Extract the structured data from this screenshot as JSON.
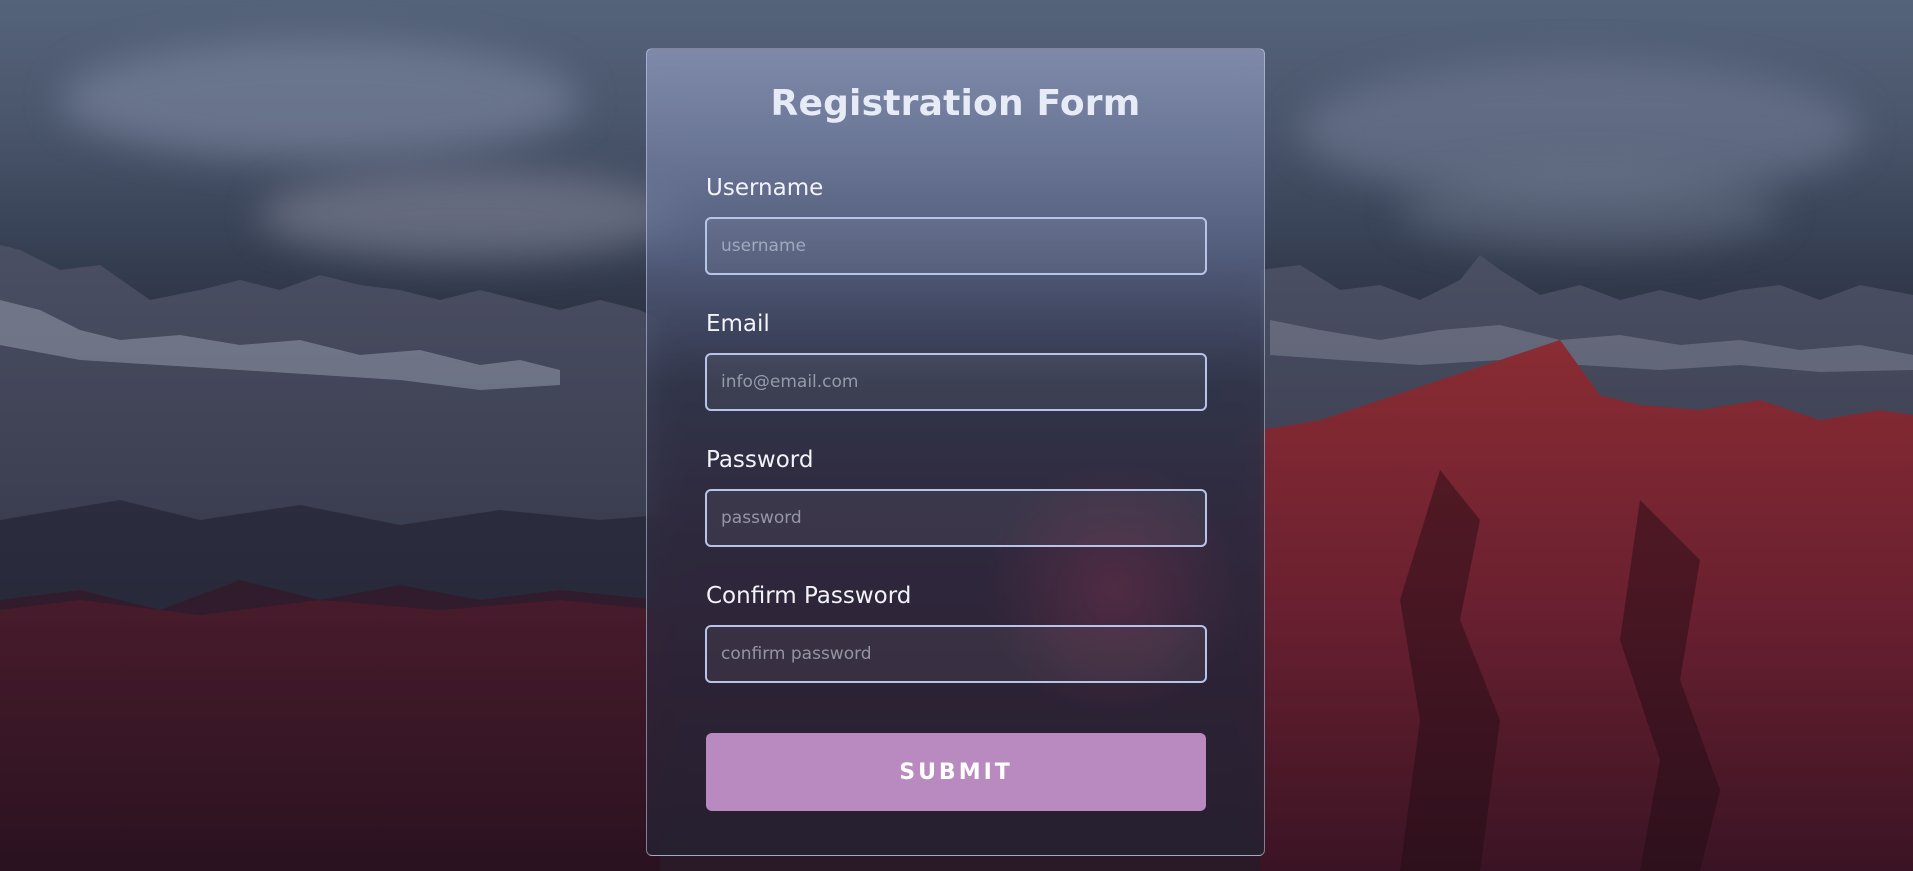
{
  "form": {
    "title": "Registration Form",
    "fields": [
      {
        "label": "Username",
        "placeholder": "username",
        "value": ""
      },
      {
        "label": "Email",
        "placeholder": "info@email.com",
        "value": ""
      },
      {
        "label": "Password",
        "placeholder": "password",
        "value": ""
      },
      {
        "label": "Confirm Password",
        "placeholder": "confirm password",
        "value": ""
      }
    ],
    "submit_label": "SUBMIT"
  },
  "colors": {
    "accent": "#b98abf",
    "input_border": "#b7c4e8",
    "title_text": "#e7ebf6"
  }
}
